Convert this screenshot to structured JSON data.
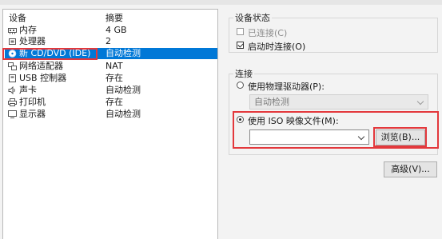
{
  "device_list": {
    "columns": {
      "device": "设备",
      "summary": "摘要"
    },
    "items": [
      {
        "icon": "memory-icon",
        "name": "内存",
        "summary": "4 GB"
      },
      {
        "icon": "processor-icon",
        "name": "处理器",
        "summary": "2"
      },
      {
        "icon": "cd-dvd-icon",
        "name": "新 CD/DVD (IDE)",
        "summary": "自动检测",
        "selected": true
      },
      {
        "icon": "network-adapter-icon",
        "name": "网络适配器",
        "summary": "NAT"
      },
      {
        "icon": "usb-icon",
        "name": "USB 控制器",
        "summary": "存在"
      },
      {
        "icon": "sound-card-icon",
        "name": "声卡",
        "summary": "自动检测"
      },
      {
        "icon": "printer-icon",
        "name": "打印机",
        "summary": "存在"
      },
      {
        "icon": "display-icon",
        "name": "显示器",
        "summary": "自动检测"
      }
    ]
  },
  "device_status": {
    "title": "设备状态",
    "connected": {
      "label": "已连接(C)",
      "checked": false,
      "enabled": false
    },
    "connect_at_power_on": {
      "label": "启动时连接(O)",
      "checked": true,
      "enabled": true
    }
  },
  "connection": {
    "title": "连接",
    "physical_drive": {
      "label": "使用物理驱动器(P):",
      "selected": false
    },
    "physical_drive_select": {
      "value": "自动检测"
    },
    "iso_image": {
      "label": "使用 ISO 映像文件(M):",
      "selected": true
    },
    "iso_path": {
      "value": ""
    },
    "browse_button": "浏览(B)..."
  },
  "advanced_button": "高级(V)...",
  "colors": {
    "selection": "#0078d7",
    "highlight_outline": "#e3383c"
  }
}
